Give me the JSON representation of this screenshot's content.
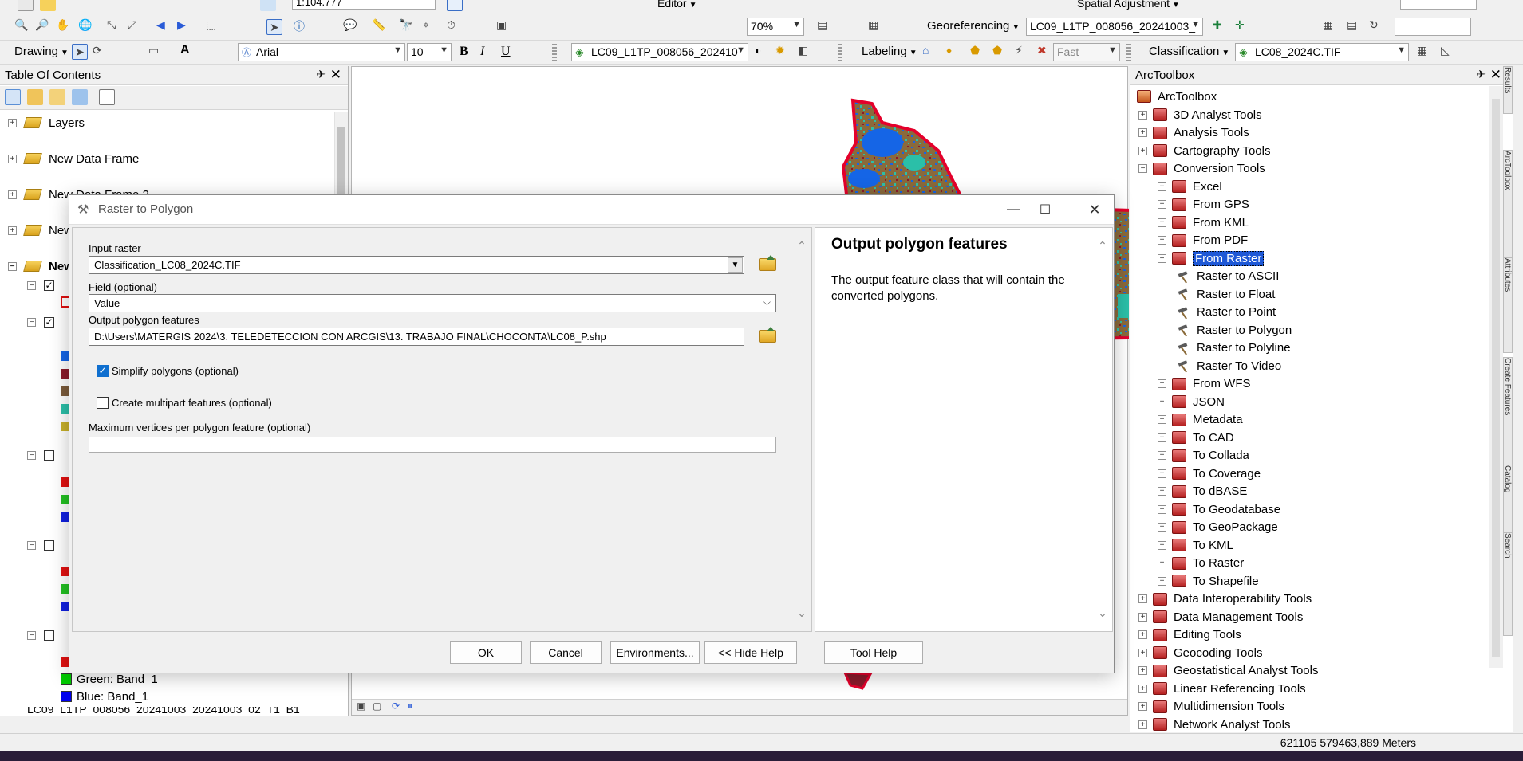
{
  "toolbars": {
    "scale_value": "1:104.777",
    "editor_label": "Editor",
    "spatial_adjustment_label": "Spatial Adjustment",
    "georeferencing_label": "Georeferencing",
    "georef_layer": "LC09_L1TP_008056_20241003_",
    "zoom_percent": "70%",
    "drawing_label": "Drawing",
    "font_name": "Arial",
    "font_size": "10",
    "bold": "B",
    "italic": "I",
    "underline": "U",
    "text_a": "A",
    "raster_layer": "LC09_L1TP_008056_202410",
    "labeling_label": "Labeling",
    "label_quality": "Fast",
    "classification_label": "Classification",
    "classification_layer": "LC08_2024C.TIF"
  },
  "toc": {
    "title": "Table Of Contents",
    "pin": "✈",
    "close": "✕",
    "frames": [
      {
        "label": "Layers"
      },
      {
        "label": "New Data Frame"
      },
      {
        "label": "New Data Frame 2"
      },
      {
        "label": "New"
      },
      {
        "label": "New"
      }
    ],
    "legend_rows": [
      {
        "band": "Green:",
        "value": "Band_1",
        "color": "#00cc00"
      },
      {
        "band": "Blue:",
        "value": "Band_1",
        "color": "#0000ee"
      }
    ],
    "cut_row": "LC09_L1TP_008056_20241003_20241003_02_T1_B1"
  },
  "colors": {
    "swatches": [
      "#1565e6",
      "#8b1a2b",
      "#7a5a3a",
      "#2bbfa8",
      "#c8b12a",
      "#e01010",
      "#22c022",
      "#1020e0",
      "#e01010",
      "#22c022",
      "#1020e0",
      "#e01010"
    ],
    "accent": "#1e58d6",
    "map_outline": "#e4002b"
  },
  "toolbox": {
    "title": "ArcToolbox",
    "root": "ArcToolbox",
    "items": [
      {
        "label": "3D Analyst Tools",
        "level": 0,
        "type": "box",
        "exp": "+"
      },
      {
        "label": "Analysis Tools",
        "level": 0,
        "type": "box",
        "exp": "+"
      },
      {
        "label": "Cartography Tools",
        "level": 0,
        "type": "box",
        "exp": "+"
      },
      {
        "label": "Conversion Tools",
        "level": 0,
        "type": "box",
        "exp": "-"
      },
      {
        "label": "Excel",
        "level": 1,
        "type": "box",
        "exp": "+"
      },
      {
        "label": "From GPS",
        "level": 1,
        "type": "box",
        "exp": "+"
      },
      {
        "label": "From KML",
        "level": 1,
        "type": "box",
        "exp": "+"
      },
      {
        "label": "From PDF",
        "level": 1,
        "type": "box",
        "exp": "+"
      },
      {
        "label": "From Raster",
        "level": 1,
        "type": "box",
        "exp": "-",
        "selected": true
      },
      {
        "label": "Raster to ASCII",
        "level": 2,
        "type": "tool"
      },
      {
        "label": "Raster to Float",
        "level": 2,
        "type": "tool"
      },
      {
        "label": "Raster to Point",
        "level": 2,
        "type": "tool"
      },
      {
        "label": "Raster to Polygon",
        "level": 2,
        "type": "tool"
      },
      {
        "label": "Raster to Polyline",
        "level": 2,
        "type": "tool"
      },
      {
        "label": "Raster To Video",
        "level": 2,
        "type": "tool"
      },
      {
        "label": "From WFS",
        "level": 1,
        "type": "box",
        "exp": "+"
      },
      {
        "label": "JSON",
        "level": 1,
        "type": "box",
        "exp": "+"
      },
      {
        "label": "Metadata",
        "level": 1,
        "type": "box",
        "exp": "+"
      },
      {
        "label": "To CAD",
        "level": 1,
        "type": "box",
        "exp": "+"
      },
      {
        "label": "To Collada",
        "level": 1,
        "type": "box",
        "exp": "+"
      },
      {
        "label": "To Coverage",
        "level": 1,
        "type": "box",
        "exp": "+"
      },
      {
        "label": "To dBASE",
        "level": 1,
        "type": "box",
        "exp": "+"
      },
      {
        "label": "To Geodatabase",
        "level": 1,
        "type": "box",
        "exp": "+"
      },
      {
        "label": "To GeoPackage",
        "level": 1,
        "type": "box",
        "exp": "+"
      },
      {
        "label": "To KML",
        "level": 1,
        "type": "box",
        "exp": "+"
      },
      {
        "label": "To Raster",
        "level": 1,
        "type": "box",
        "exp": "+"
      },
      {
        "label": "To Shapefile",
        "level": 1,
        "type": "box",
        "exp": "+"
      },
      {
        "label": "Data Interoperability Tools",
        "level": 0,
        "type": "box",
        "exp": "+"
      },
      {
        "label": "Data Management Tools",
        "level": 0,
        "type": "box",
        "exp": "+"
      },
      {
        "label": "Editing Tools",
        "level": 0,
        "type": "box",
        "exp": "+"
      },
      {
        "label": "Geocoding Tools",
        "level": 0,
        "type": "box",
        "exp": "+"
      },
      {
        "label": "Geostatistical Analyst Tools",
        "level": 0,
        "type": "box",
        "exp": "+"
      },
      {
        "label": "Linear Referencing Tools",
        "level": 0,
        "type": "box",
        "exp": "+"
      },
      {
        "label": "Multidimension Tools",
        "level": 0,
        "type": "box",
        "exp": "+"
      },
      {
        "label": "Network Analyst Tools",
        "level": 0,
        "type": "box",
        "exp": "+"
      }
    ],
    "side_tabs": [
      "Results",
      "ArcToolbox",
      "Attributes",
      "Create Features",
      "Catalog",
      "Search"
    ]
  },
  "dialog": {
    "title": "Raster to Polygon",
    "minimize": "—",
    "maximize": "☐",
    "close": "✕",
    "input_raster_label": "Input raster",
    "input_raster_value": "Classification_LC08_2024C.TIF",
    "field_label": "Field (optional)",
    "field_value": "Value",
    "output_label": "Output polygon features",
    "output_value": "D:\\Users\\MATERGIS 2024\\3. TELEDETECCION CON ARCGIS\\13. TRABAJO FINAL\\CHOCONTA\\LC08_P.shp",
    "simplify_label": "Simplify polygons (optional)",
    "simplify_checked": true,
    "multipart_label": "Create multipart features (optional)",
    "multipart_checked": false,
    "maxvert_label": "Maximum vertices per polygon feature (optional)",
    "maxvert_value": "",
    "help_title": "Output polygon features",
    "help_body": "The output feature class that will contain the converted polygons.",
    "buttons": {
      "ok": "OK",
      "cancel": "Cancel",
      "env": "Environments...",
      "hide_help": "<< Hide Help",
      "tool_help": "Tool Help"
    }
  },
  "status": {
    "coords": "621105  579463,889 Meters"
  }
}
